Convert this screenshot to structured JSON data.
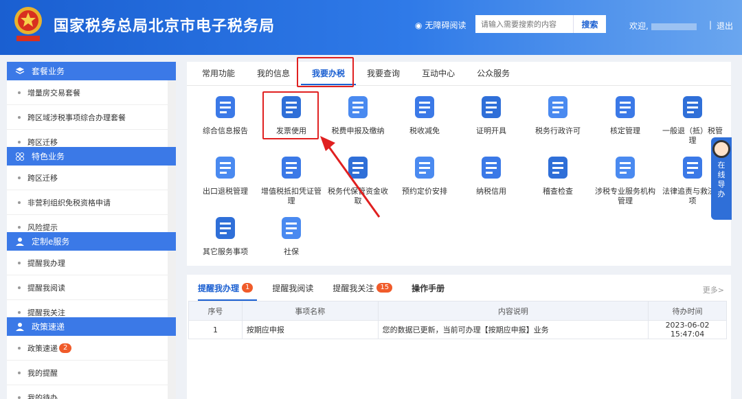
{
  "header": {
    "title": "国家税务总局北京市电子税务局",
    "accessibility": "无障碍阅读",
    "search_placeholder": "请输入需要搜索的内容",
    "search_button": "搜索",
    "welcome": "欢迎,",
    "separator": "|",
    "logout": "退出"
  },
  "sidebar": {
    "sections": [
      {
        "title": "套餐业务",
        "items": [
          "增量房交易套餐",
          "跨区域涉税事项综合办理套餐",
          "跨区迁移"
        ]
      },
      {
        "title": "特色业务",
        "items": [
          "跨区迁移",
          "非营利组织免税资格申请",
          "风险提示"
        ]
      },
      {
        "title": "定制e服务",
        "items": [
          "提醒我办理",
          "提醒我阅读",
          "提醒我关注"
        ]
      },
      {
        "title": "政策速递",
        "items": [
          "政策速递",
          "我的提醒",
          "我的待办"
        ],
        "badge": "2"
      }
    ]
  },
  "main": {
    "tabs": [
      "常用功能",
      "我的信息",
      "我要办税",
      "我要查询",
      "互动中心",
      "公众服务"
    ],
    "active_tab": "我要办税",
    "services": [
      {
        "label": "综合信息报告",
        "icon": "report-icon"
      },
      {
        "label": "发票使用",
        "icon": "invoice-icon"
      },
      {
        "label": "税费申报及缴纳",
        "icon": "tax-payment-icon"
      },
      {
        "label": "税收减免",
        "icon": "tax-reduction-icon"
      },
      {
        "label": "证明开具",
        "icon": "certificate-icon"
      },
      {
        "label": "税务行政许可",
        "icon": "license-icon"
      },
      {
        "label": "核定管理",
        "icon": "approval-icon"
      },
      {
        "label": "一般退（抵）税管理",
        "icon": "refund-icon"
      },
      {
        "label": "出口退税管理",
        "icon": "export-refund-icon"
      },
      {
        "label": "增值税抵扣凭证管理",
        "icon": "vat-voucher-icon"
      },
      {
        "label": "税务代保管资金收取",
        "icon": "custody-fund-icon"
      },
      {
        "label": "预约定价安排",
        "icon": "pricing-icon"
      },
      {
        "label": "纳税信用",
        "icon": "credit-icon"
      },
      {
        "label": "稽查检查",
        "icon": "inspection-icon"
      },
      {
        "label": "涉税专业服务机构管理",
        "icon": "agency-icon"
      },
      {
        "label": "法律追责与救济事项",
        "icon": "gavel-icon"
      },
      {
        "label": "其它服务事项",
        "icon": "other-service-icon"
      },
      {
        "label": "社保",
        "icon": "social-security-icon"
      }
    ]
  },
  "reminders": {
    "tabs": [
      {
        "label": "提醒我办理",
        "count": "1"
      },
      {
        "label": "提醒我阅读",
        "count": ""
      },
      {
        "label": "提醒我关注",
        "count": "15"
      },
      {
        "label": "操作手册",
        "count": ""
      }
    ],
    "more": "更多>",
    "columns": [
      "序号",
      "事项名称",
      "内容说明",
      "待办时间"
    ],
    "rows": [
      {
        "no": "1",
        "name": "按期应申报",
        "desc": "您的数据已更新，当前可办理【按期应申报】业务",
        "time": "2023-06-02 15:47:04"
      }
    ]
  },
  "helper": {
    "text": "在线导办"
  },
  "colors": {
    "primary": "#1a5fd1",
    "accent": "#3b79e7",
    "badge": "#f05b2a",
    "highlight": "#e02020"
  }
}
